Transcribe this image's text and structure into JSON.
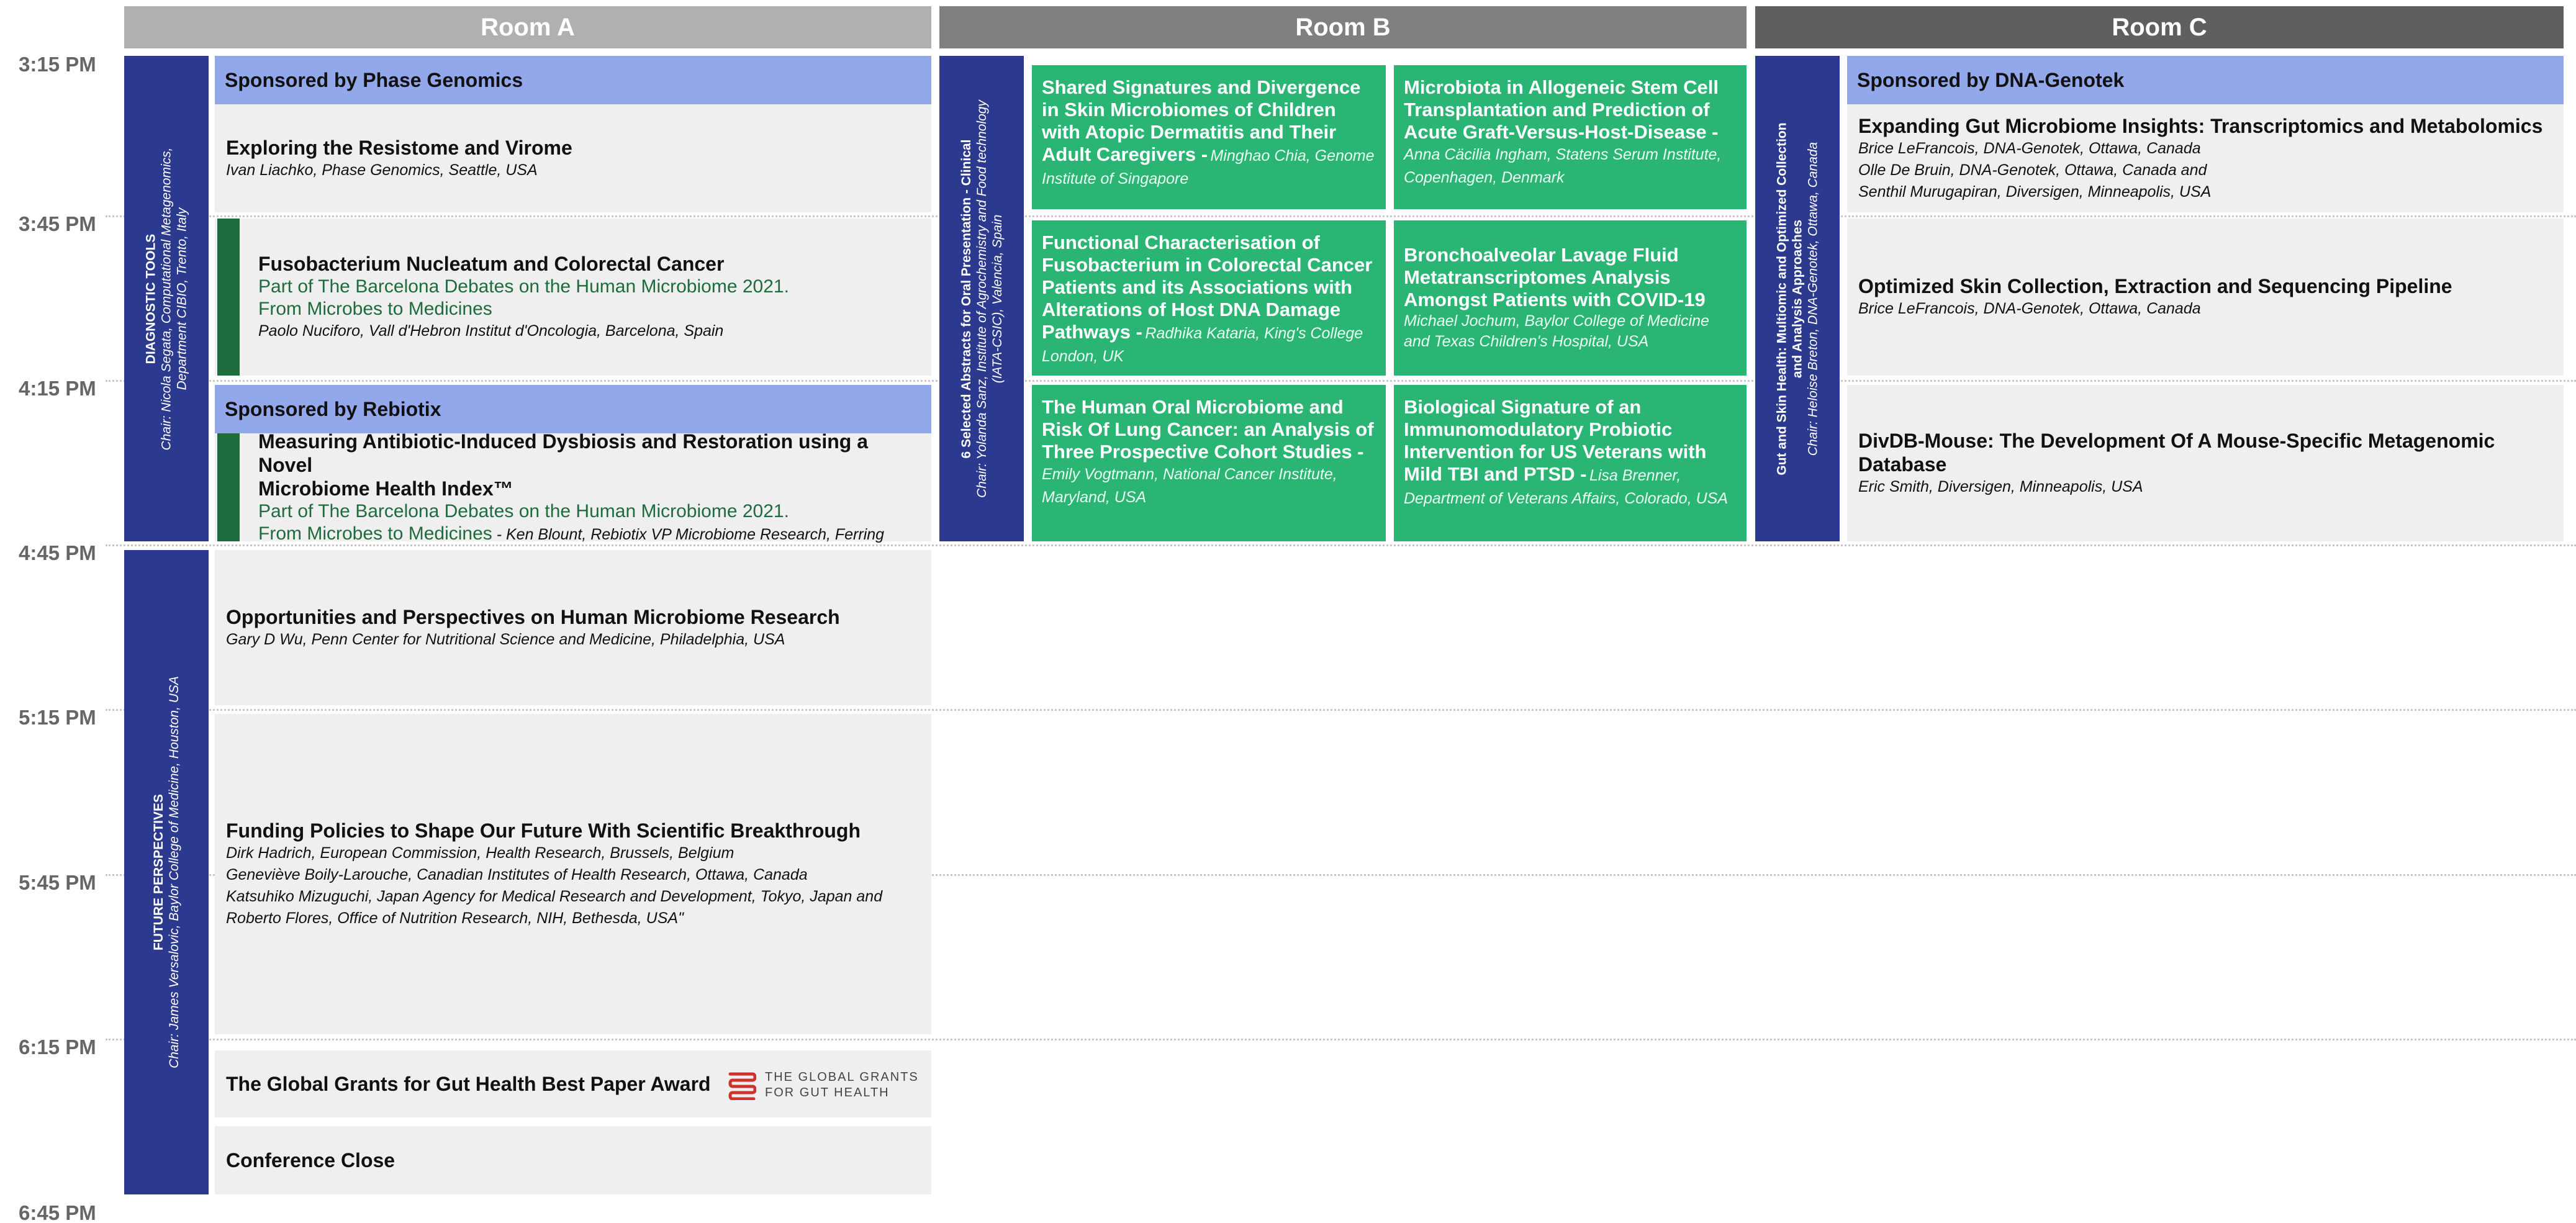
{
  "rooms": {
    "a": "Room A",
    "b": "Room B",
    "c": "Room C"
  },
  "colors": {
    "room_a": "#b0b0b0",
    "room_b": "#808080",
    "room_c": "#5f5f5f",
    "chair": "#2b3a8f",
    "sponsor": "#92a8ea",
    "session": "#efefef",
    "green": "#2bb574",
    "dark_green": "#1e6b3d"
  },
  "times": [
    "3:15 PM",
    "3:45 PM",
    "4:15 PM",
    "4:45 PM",
    "5:15 PM",
    "5:45 PM",
    "6:15 PM",
    "6:45 PM"
  ],
  "room_a": {
    "chair1": {
      "title": "DIAGNOSTIC TOOLS",
      "line1": "Chair: Nicola Segata, Computational Metagenomics,",
      "line2": "Department CIBIO, Trento, Italy"
    },
    "sponsor1": "Sponsored by Phase Genomics",
    "s1": {
      "title": "Exploring the Resistome and Virome",
      "speaker": "Ivan Liachko, Phase Genomics, Seattle, USA"
    },
    "s2": {
      "title": "Fusobacterium Nucleatum and Colorectal Cancer",
      "part1": "Part of The Barcelona Debates on the Human Microbiome 2021.",
      "part2": "From Microbes to Medicines",
      "speaker": "Paolo Nuciforo, Vall d'Hebron Institut d'Oncologia, Barcelona, Spain"
    },
    "sponsor2": "Sponsored by Rebiotix",
    "s3": {
      "title1": "Measuring Antibiotic-Induced Dysbiosis and Restoration using a Novel",
      "title2": "Microbiome Health Index™",
      "part1": "Part of The Barcelona Debates on the Human Microbiome 2021.",
      "part2": "From Microbes to Medicines",
      "speaker": " - Ken Blount, Rebiotix VP Microbiome Research, Ferring"
    },
    "chair2": {
      "title": "FUTURE PERSPECTIVES",
      "line1": "Chair: James Versalovic, Baylor College of Medicine, Houston, USA"
    },
    "s4": {
      "title": "Opportunities and Perspectives on Human Microbiome Research",
      "speaker": "Gary D Wu, Penn Center for Nutritional Science and Medicine, Philadelphia, USA"
    },
    "s5": {
      "title": "Funding Policies to Shape Our Future With Scientific Breakthrough",
      "speakers": [
        "Dirk Hadrich, European Commission, Health Research, Brussels, Belgium",
        "Geneviève Boily-Larouche, Canadian Institutes of Health Research, Ottawa, Canada",
        "Katsuhiko Mizuguchi, Japan Agency for Medical Research and Development, Tokyo, Japan and",
        "Roberto Flores, Office of Nutrition Research, NIH, Bethesda, USA\""
      ]
    },
    "s6": {
      "title": "The Global Grants for Gut Health Best Paper Award",
      "logo_line1": "THE GLOBAL GRANTS",
      "logo_line2": "FOR GUT HEALTH"
    },
    "s7": {
      "title": "Conference Close"
    }
  },
  "room_b": {
    "chair": {
      "title": "6 Selected Abstracts for Oral Presentation - Clinical",
      "line1": "Chair: Yolanda Sanz, Institute of Agrochemistry and Food technology",
      "line2": "(IATA-CSIC), Valencia, Spain"
    },
    "abstracts": [
      {
        "title": "Shared Signatures and Divergence in Skin Microbiomes of Children with Atopic Dermatitis and Their Adult Caregivers -",
        "speaker": "Minghao Chia, Genome Institute of Singapore"
      },
      {
        "title": "Microbiota in Allogeneic Stem Cell Transplantation and Prediction of Acute Graft-Versus-Host-Disease -",
        "speaker": "Anna Cäcilia Ingham, Statens Serum Institute, Copenhagen, Denmark"
      },
      {
        "title": "Functional Characterisation of Fusobacterium in Colorectal Cancer Patients and its Associations with Alterations of Host DNA Damage Pathways -",
        "speaker": "Radhika Kataria, King's College London, UK"
      },
      {
        "title": "Bronchoalveolar Lavage Fluid Metatranscriptomes Analysis Amongst Patients with COVID-19",
        "speaker": "Michael Jochum, Baylor College of Medicine and Texas Children's Hospital, USA"
      },
      {
        "title": "The Human Oral Microbiome and Risk Of Lung Cancer: an Analysis of Three Prospective Cohort Studies -",
        "speaker": "Emily Vogtmann, National Cancer Institute, Maryland, USA"
      },
      {
        "title": "Biological Signature of an Immunomodulatory Probiotic Intervention for US Veterans with Mild TBI and PTSD -",
        "speaker": "Lisa Brenner, Department of Veterans Affairs, Colorado, USA"
      }
    ]
  },
  "room_c": {
    "chair": {
      "title1": "Gut and Skin Health: Multiomic and Optimized Collection",
      "title2": "and Analysis Approaches",
      "line1": "Chair: Heloise Breton, DNA-Genotek, Ottawa, Canada"
    },
    "sponsor": "Sponsored by DNA-Genotek",
    "s1": {
      "title": "Expanding Gut Microbiome Insights: Transcriptomics and Metabolomics",
      "speakers": [
        "Brice LeFrancois, DNA-Genotek, Ottawa, Canada",
        "Olle De Bruin, DNA-Genotek, Ottawa, Canada and",
        "Senthil Murugapiran, Diversigen, Minneapolis, USA"
      ]
    },
    "s2": {
      "title": "Optimized Skin Collection, Extraction and Sequencing Pipeline",
      "speaker": "Brice LeFrancois, DNA-Genotek, Ottawa, Canada"
    },
    "s3": {
      "title": "DivDB-Mouse: The Development Of A Mouse-Specific Metagenomic Database",
      "speaker": "Eric Smith, Diversigen, Minneapolis, USA"
    }
  }
}
